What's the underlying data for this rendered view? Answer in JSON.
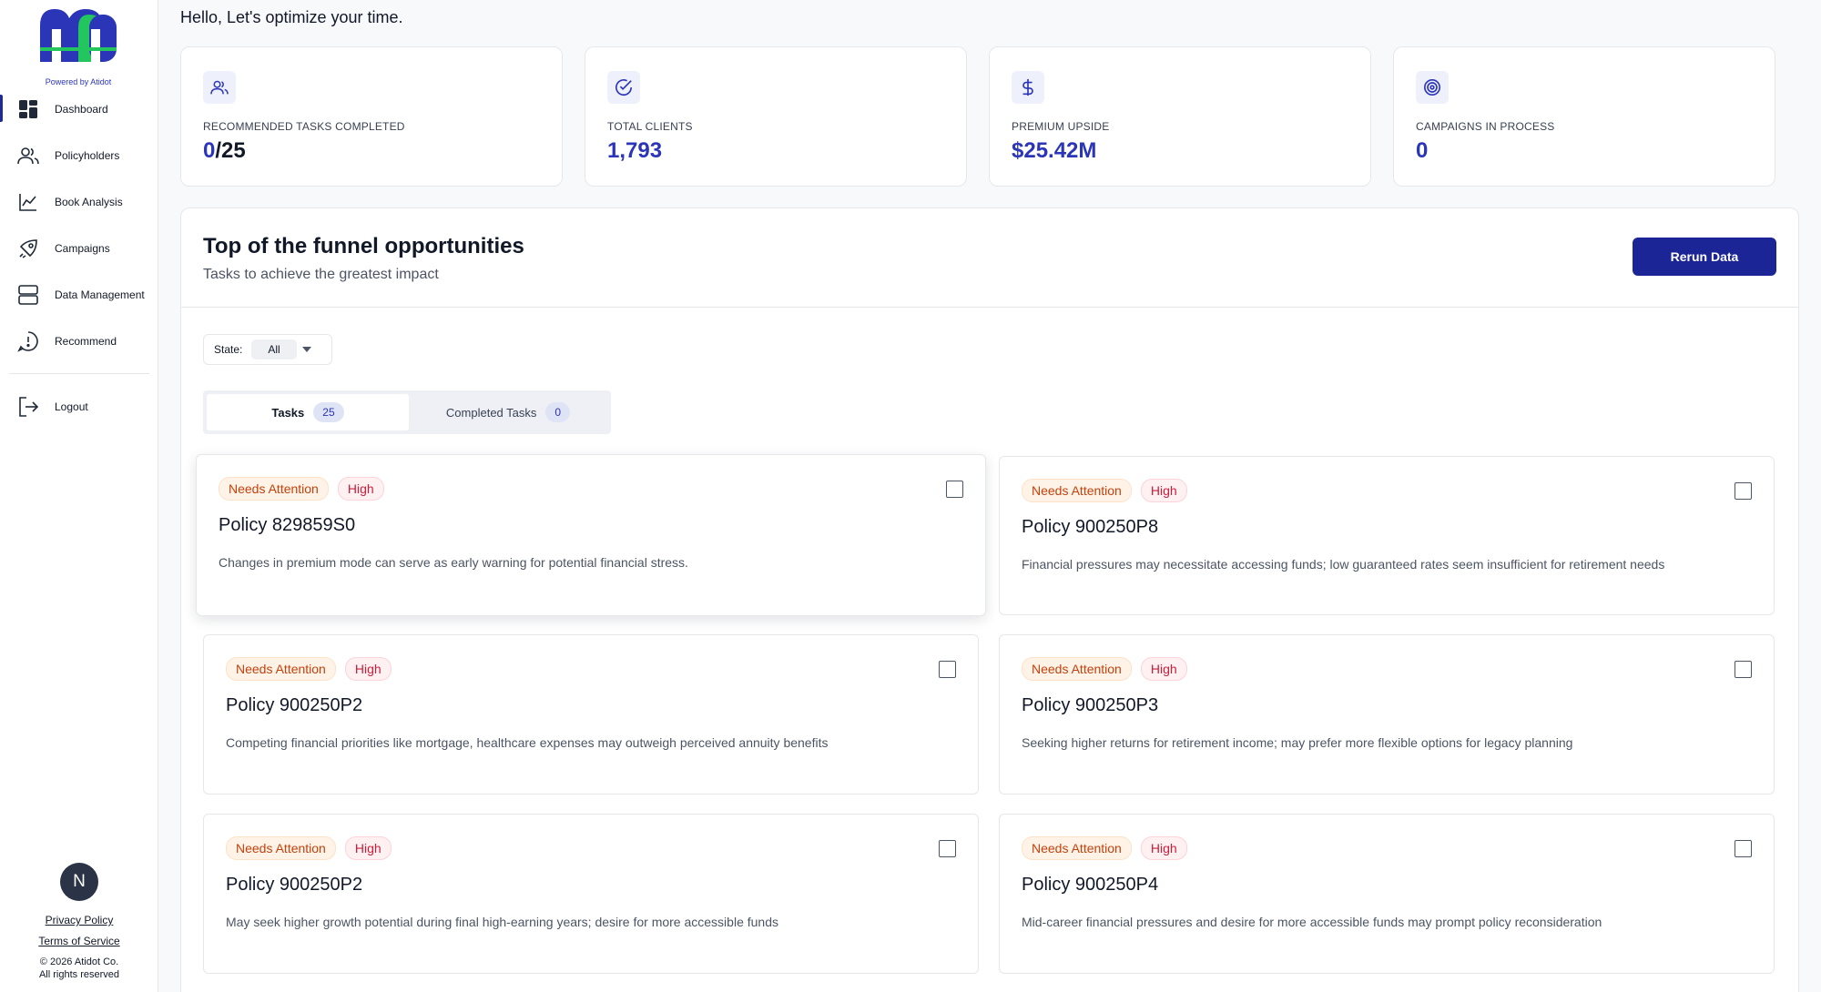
{
  "app": {
    "logo_caption": "Powered by Atidot",
    "brand_colors": {
      "primary": "#2b35b8",
      "accent": "#22c55e",
      "button": "#1c2596"
    }
  },
  "sidebar": {
    "items": [
      {
        "label": "Dashboard",
        "icon": "dashboard-grid-icon"
      },
      {
        "label": "Policyholders",
        "icon": "users-icon"
      },
      {
        "label": "Book Analysis",
        "icon": "line-chart-icon"
      },
      {
        "label": "Campaigns",
        "icon": "rocket-icon"
      },
      {
        "label": "Data Management",
        "icon": "server-stack-icon"
      },
      {
        "label": "Recommend",
        "icon": "alert-bubble-icon"
      }
    ],
    "logout": {
      "label": "Logout",
      "icon": "logout-icon"
    },
    "avatar_initial": "N",
    "privacy_link": "Privacy Policy",
    "terms_link": "Terms of Service",
    "copyright_line1": "© 2026 Atidot Co.",
    "copyright_line2": "All rights reserved"
  },
  "header": {
    "greeting": "Hello, Let's optimize your time."
  },
  "stats": [
    {
      "label": "RECOMMENDED TASKS COMPLETED",
      "value_main": "0",
      "value_suffix": "/25",
      "icon": "users-icon"
    },
    {
      "label": "TOTAL CLIENTS",
      "value_main": "1,793",
      "value_suffix": "",
      "icon": "check-circle-icon"
    },
    {
      "label": "PREMIUM UPSIDE",
      "value_main": "$25.42M",
      "value_suffix": "",
      "icon": "dollar-icon"
    },
    {
      "label": "CAMPAIGNS IN PROCESS",
      "value_main": "0",
      "value_suffix": "",
      "icon": "target-icon"
    }
  ],
  "panel": {
    "title": "Top of the funnel opportunities",
    "subtitle": "Tasks to achieve the greatest impact",
    "rerun_label": "Rerun Data",
    "filter": {
      "label": "State:",
      "value": "All"
    },
    "tabs": [
      {
        "label": "Tasks",
        "count": "25"
      },
      {
        "label": "Completed Tasks",
        "count": "0"
      }
    ]
  },
  "tasks": [
    {
      "status": "Needs Attention",
      "priority": "High",
      "title": "Policy 829859S0",
      "desc": "Changes in premium mode can serve as early warning for potential financial stress."
    },
    {
      "status": "Needs Attention",
      "priority": "High",
      "title": "Policy 900250P8",
      "desc": "Financial pressures may necessitate accessing funds; low guaranteed rates seem insufficient for retirement needs"
    },
    {
      "status": "Needs Attention",
      "priority": "High",
      "title": "Policy 900250P2",
      "desc": "Competing financial priorities like mortgage, healthcare expenses may outweigh perceived annuity benefits"
    },
    {
      "status": "Needs Attention",
      "priority": "High",
      "title": "Policy 900250P3",
      "desc": "Seeking higher returns for retirement income; may prefer more flexible options for legacy planning"
    },
    {
      "status": "Needs Attention",
      "priority": "High",
      "title": "Policy 900250P2",
      "desc": "May seek higher growth potential during final high-earning years; desire for more accessible funds"
    },
    {
      "status": "Needs Attention",
      "priority": "High",
      "title": "Policy 900250P4",
      "desc": "Mid-career financial pressures and desire for more accessible funds may prompt policy reconsideration"
    }
  ]
}
